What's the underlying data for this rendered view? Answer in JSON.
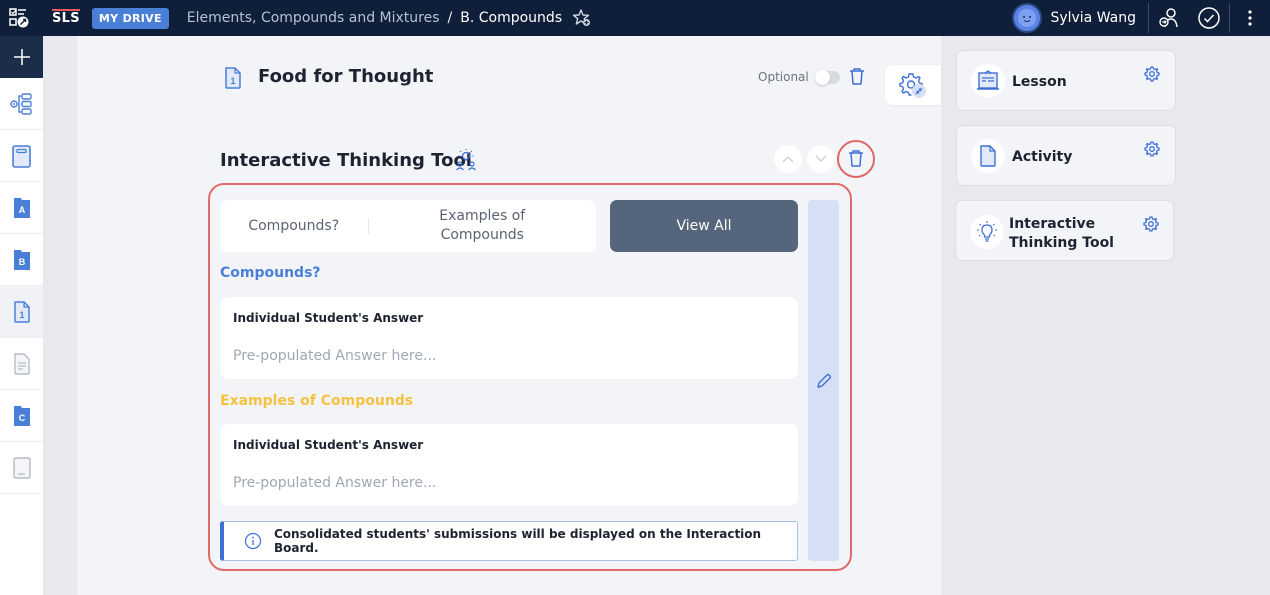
{
  "topbar": {
    "logo": "SLS",
    "drive_label": "MY DRIVE",
    "breadcrumb_parent": "Elements, Compounds and Mixtures",
    "breadcrumb_separator": "/",
    "breadcrumb_current": "B. Compounds",
    "user_name": "Sylvia Wang"
  },
  "rail": {
    "items": [
      {
        "icon": "plus-icon"
      },
      {
        "icon": "lesson-map-icon"
      },
      {
        "icon": "notebook-icon"
      },
      {
        "icon": "folder-a-icon",
        "letter": "A"
      },
      {
        "icon": "folder-b-icon",
        "letter": "B"
      },
      {
        "icon": "page-1-icon",
        "letter": "1",
        "active": true
      },
      {
        "icon": "document-icon"
      },
      {
        "icon": "folder-c-icon",
        "letter": "C"
      },
      {
        "icon": "book-icon"
      }
    ]
  },
  "activity": {
    "title": "Food for Thought",
    "page_number": "1",
    "optional_label": "Optional",
    "optional_enabled": false
  },
  "component": {
    "title": "Interactive Thinking Tool",
    "tabs": [
      "Compounds?",
      "Examples of Compounds"
    ],
    "view_all_label": "View All",
    "sections": [
      {
        "label": "Compounds?",
        "color": "#4a7fd8",
        "answer_label": "Individual Student's Answer",
        "placeholder": "Pre-populated Answer here..."
      },
      {
        "label": "Examples of Compounds",
        "color": "#f5c242",
        "answer_label": "Individual Student's Answer",
        "placeholder": "Pre-populated Answer here..."
      }
    ],
    "notice": "Consolidated students' submissions will be displayed on the Interaction Board."
  },
  "right_panel": {
    "cards": [
      {
        "label": "Lesson",
        "icon": "lesson-board-icon"
      },
      {
        "label": "Activity",
        "icon": "activity-page-icon"
      },
      {
        "label": "Interactive Thinking Tool",
        "icon": "lightbulb-icon"
      }
    ]
  },
  "colors": {
    "topbar": "#0f1f3a",
    "accent": "#4a7fd8",
    "highlight": "#e06b6b",
    "view_all": "#55657b"
  }
}
